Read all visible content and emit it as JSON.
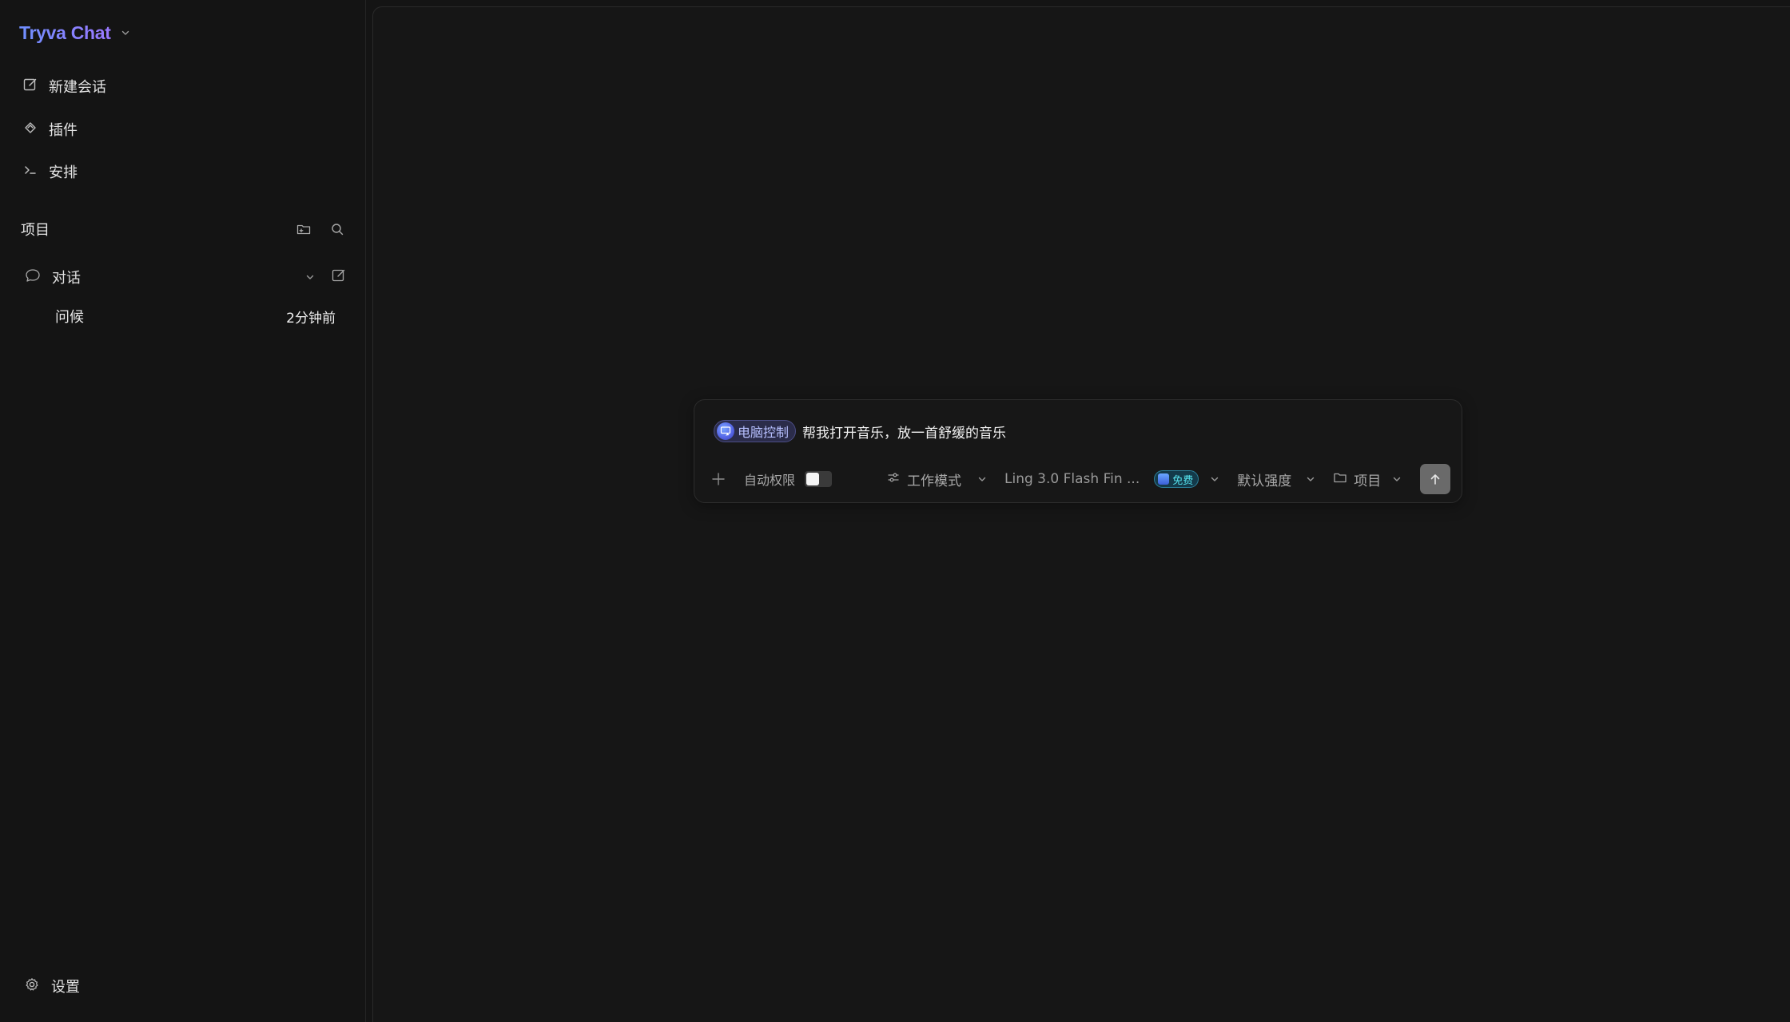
{
  "brand": {
    "name": "Tryva Chat"
  },
  "sidebar": {
    "nav": [
      {
        "label": "新建会话",
        "icon": "compose-icon"
      },
      {
        "label": "插件",
        "icon": "plugin-icon"
      },
      {
        "label": "安排",
        "icon": "terminal-icon"
      }
    ],
    "section_title": "项目",
    "group": {
      "label": "对话"
    },
    "conversations": [
      {
        "title": "问候",
        "time": "2分钟前"
      }
    ],
    "settings_label": "设置"
  },
  "composer": {
    "chip_label": "电脑控制",
    "prompt": "帮我打开音乐，放一首舒缓的音乐",
    "auto_permission_label": "自动权限",
    "auto_permission_on": false,
    "work_mode_label": "工作模式",
    "model_name": "Ling 3.0 Flash Fin ...",
    "free_badge": "免费",
    "effort_label": "默认强度",
    "project_label": "项目"
  },
  "colors": {
    "background": "#141414",
    "brand_gradient_start": "#6f8fff",
    "brand_gradient_end": "#9a78ff",
    "chip_bg": "#2b2c4a",
    "free_badge_text": "#56e3ee",
    "send_button": "#6a6a6a"
  }
}
